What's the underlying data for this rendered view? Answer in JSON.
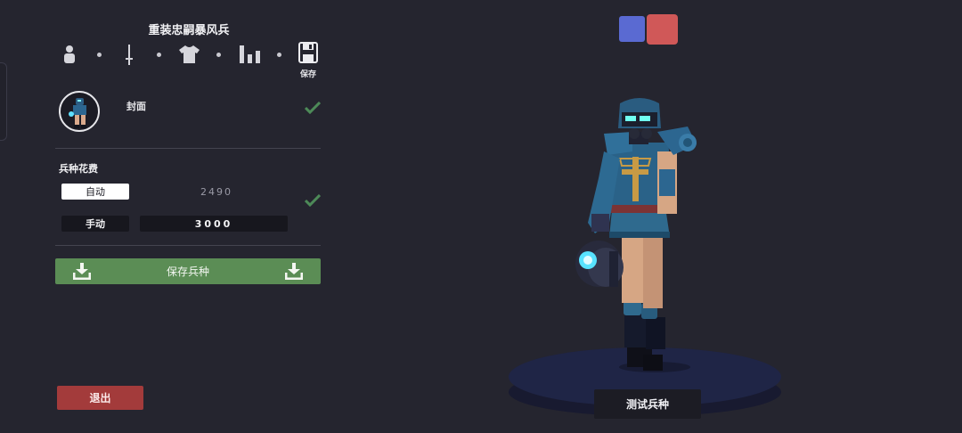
{
  "unit_name": "重装忠嗣暴风兵",
  "steps": [
    {
      "icon": "person-icon"
    },
    {
      "icon": "sword-icon"
    },
    {
      "icon": "shirt-icon"
    },
    {
      "icon": "stats-icon"
    },
    {
      "icon": "save-icon",
      "label": "保存"
    }
  ],
  "cover": {
    "label": "封面",
    "selected": true
  },
  "cost": {
    "label": "兵种花费",
    "auto_label": "自动",
    "auto_value": "2490",
    "manual_label": "手动",
    "manual_value": "3000",
    "mode": "auto"
  },
  "buttons": {
    "save_unit": "保存兵种",
    "exit": "退出",
    "test_unit": "测试兵种"
  },
  "colors": {
    "background": "#25252f",
    "save_green": "#5b8d55",
    "exit_red": "#a33b3b",
    "team_blue": "#5a6ad2",
    "team_red": "#d05858"
  }
}
